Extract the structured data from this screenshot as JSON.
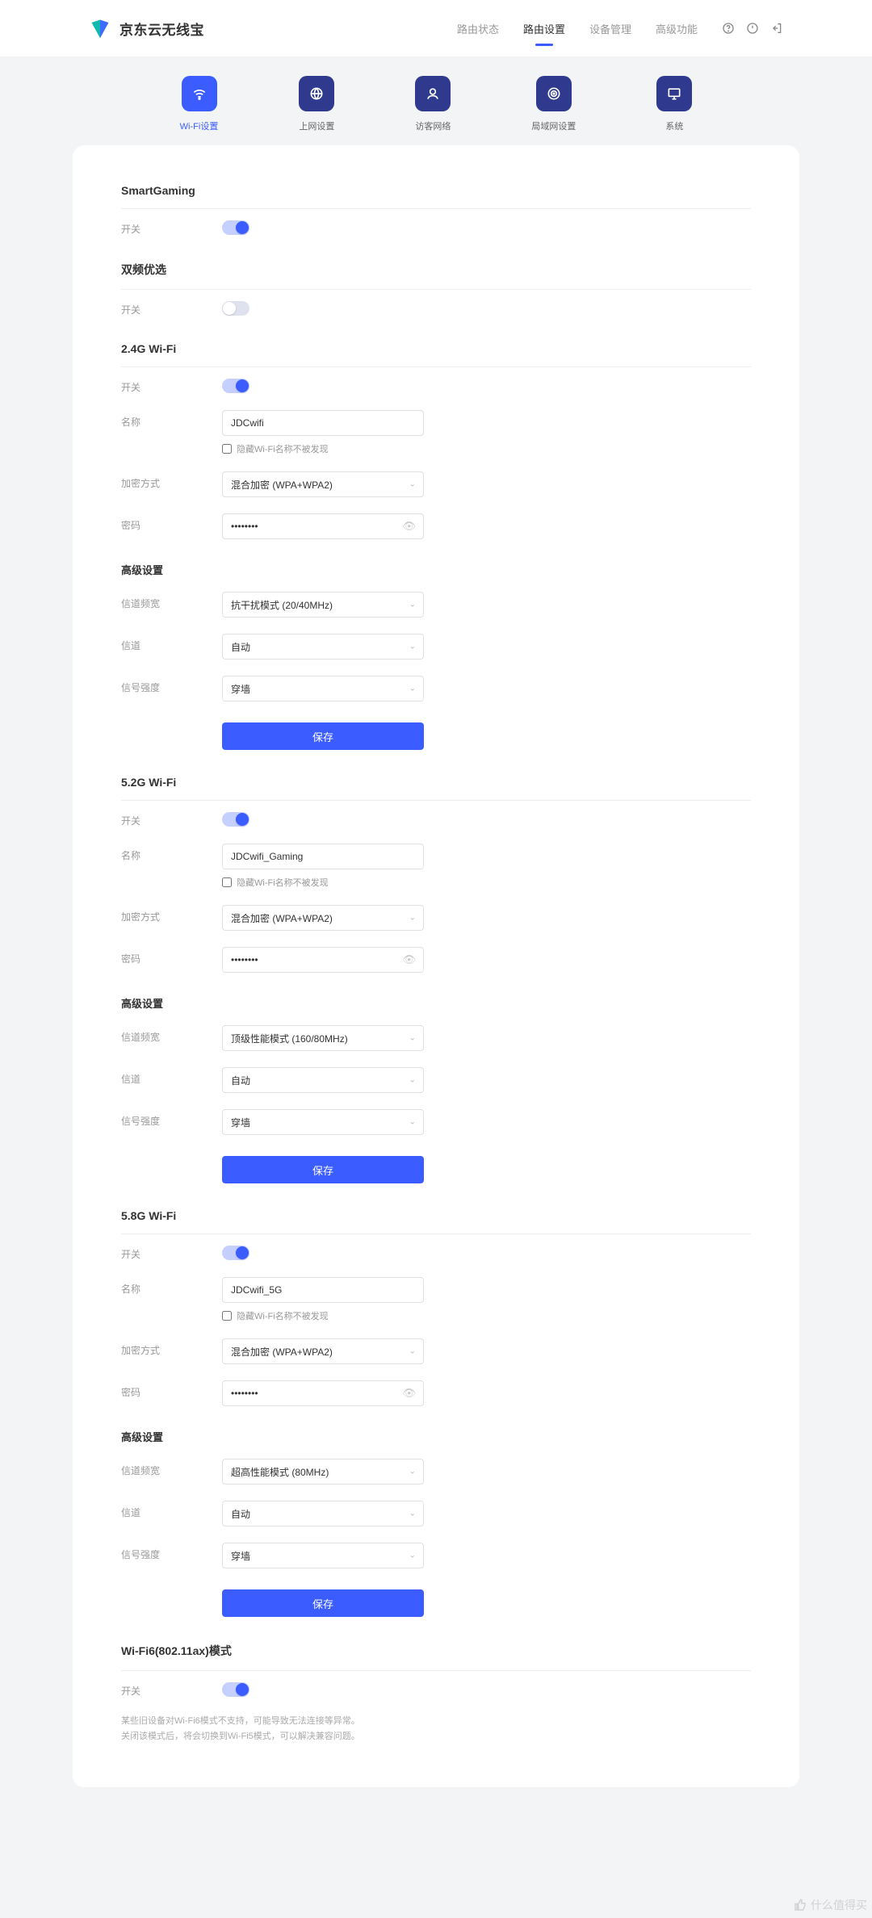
{
  "brand": "京东云无线宝",
  "nav": [
    "路由状态",
    "路由设置",
    "设备管理",
    "高级功能"
  ],
  "nav_active": 1,
  "subtabs": [
    {
      "label": "Wi-Fi设置"
    },
    {
      "label": "上网设置"
    },
    {
      "label": "访客网络"
    },
    {
      "label": "局域网设置"
    },
    {
      "label": "系统"
    }
  ],
  "labels": {
    "switch": "开关",
    "name": "名称",
    "hide_ssid": "隐藏Wi-Fi名称不被发现",
    "encryption": "加密方式",
    "password": "密码",
    "advanced": "高级设置",
    "bandwidth": "信道频宽",
    "channel": "信道",
    "signal": "信号强度",
    "save": "保存"
  },
  "sections": {
    "smartgaming": {
      "title": "SmartGaming",
      "switch": true
    },
    "dualband": {
      "title": "双频优选",
      "switch": false
    },
    "wifi24": {
      "title": "2.4G Wi-Fi",
      "switch": true,
      "name": "JDCwifi",
      "encryption": "混合加密 (WPA+WPA2)",
      "password": "••••••••",
      "bandwidth": "抗干扰模式 (20/40MHz)",
      "channel": "自动",
      "signal": "穿墙"
    },
    "wifi52": {
      "title": "5.2G Wi-Fi",
      "switch": true,
      "name": "JDCwifi_Gaming",
      "encryption": "混合加密 (WPA+WPA2)",
      "password": "••••••••",
      "bandwidth": "顶级性能模式 (160/80MHz)",
      "channel": "自动",
      "signal": "穿墙"
    },
    "wifi58": {
      "title": "5.8G Wi-Fi",
      "switch": true,
      "name": "JDCwifi_5G",
      "encryption": "混合加密 (WPA+WPA2)",
      "password": "••••••••",
      "bandwidth": "超高性能模式 (80MHz)",
      "channel": "自动",
      "signal": "穿墙"
    },
    "wifi6": {
      "title": "Wi-Fi6(802.11ax)模式",
      "switch": true,
      "note1": "某些旧设备对Wi-Fi6模式不支持，可能导致无法连接等异常。",
      "note2": "关闭该模式后，将会切换到Wi-Fi5模式，可以解决兼容问题。"
    }
  },
  "watermark": "什么值得买"
}
